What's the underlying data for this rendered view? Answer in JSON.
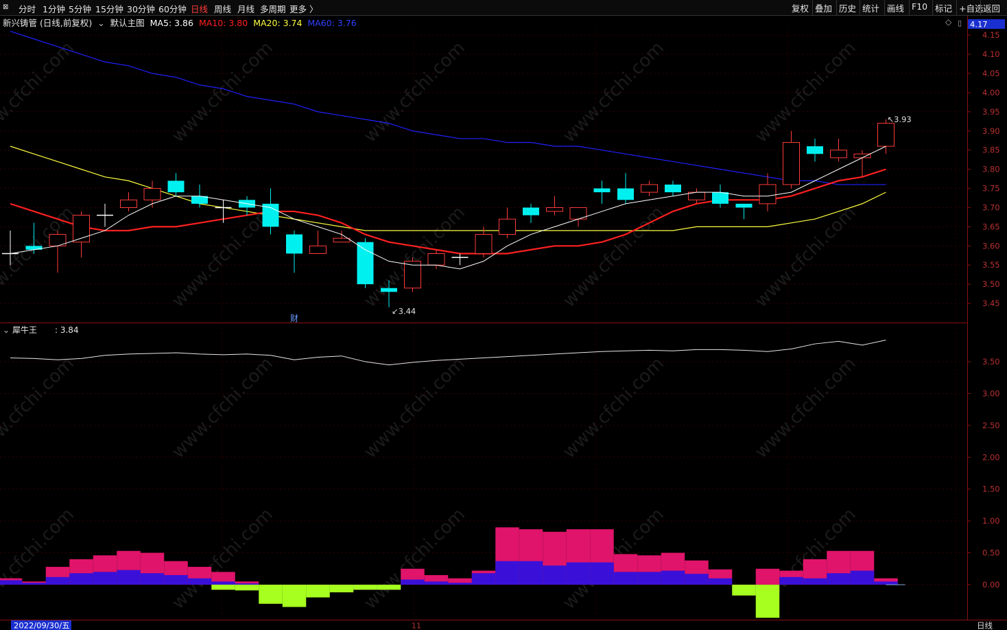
{
  "toolbar": {
    "periods": [
      {
        "label": "分时"
      },
      {
        "label": "1分钟"
      },
      {
        "label": "5分钟"
      },
      {
        "label": "15分钟"
      },
      {
        "label": "30分钟"
      },
      {
        "label": "60分钟"
      },
      {
        "label": "日线",
        "active": true
      },
      {
        "label": "周线"
      },
      {
        "label": "月线"
      },
      {
        "label": "多周期"
      },
      {
        "label": "更多 〉"
      }
    ],
    "right_tools": [
      {
        "label": "复权"
      },
      {
        "label": "叠加"
      },
      {
        "label": "历史"
      },
      {
        "label": "统计"
      },
      {
        "label": "画线"
      },
      {
        "label": "F10"
      },
      {
        "label": "标记"
      },
      {
        "label": "+自选"
      },
      {
        "label": "返回"
      }
    ]
  },
  "header": {
    "stock": "新兴铸管 (日线,前复权)",
    "template": "默认主图",
    "ma5": "MA5: 3.86",
    "ma10": "MA10: 3.80",
    "ma20": "MA20: 3.74",
    "ma60": "MA60: 3.76",
    "price_box": "4.17"
  },
  "indicator": {
    "name": "犀牛王",
    "value": ": 3.84"
  },
  "footer": {
    "date": "2022/09/30/五",
    "month_mark": "11",
    "period": "日线"
  },
  "markers": {
    "low": "3.44",
    "high": "3.93",
    "cai": "财"
  },
  "watermark": "www.cfchi.com",
  "colors": {
    "up": "#ff3b3b",
    "down": "#00f0f0",
    "ma5": "#ffffff",
    "ma10": "#ff2020",
    "ma20": "#ffff40",
    "ma60": "#2020ff",
    "hist_pink": "#e0146a",
    "hist_blue": "#3a10d8",
    "hist_green": "#a6ff1e"
  },
  "chart_data": [
    {
      "type": "candlestick",
      "title": "新兴铸管 (日线,前复权)",
      "ylim": [
        3.4,
        4.17
      ],
      "yticks": [
        3.45,
        3.5,
        3.55,
        3.6,
        3.65,
        3.7,
        3.75,
        3.8,
        3.85,
        3.9,
        3.95,
        4.0,
        4.05,
        4.1,
        4.15
      ],
      "candles": [
        {
          "o": 3.58,
          "c": 3.58,
          "h": 3.64,
          "l": 3.55
        },
        {
          "o": 3.6,
          "c": 3.59,
          "h": 3.66,
          "l": 3.58
        },
        {
          "o": 3.6,
          "c": 3.63,
          "h": 3.64,
          "l": 3.53
        },
        {
          "o": 3.61,
          "c": 3.68,
          "h": 3.69,
          "l": 3.57
        },
        {
          "o": 3.68,
          "c": 3.68,
          "h": 3.71,
          "l": 3.65
        },
        {
          "o": 3.7,
          "c": 3.72,
          "h": 3.74,
          "l": 3.69
        },
        {
          "o": 3.72,
          "c": 3.75,
          "h": 3.77,
          "l": 3.7
        },
        {
          "o": 3.77,
          "c": 3.74,
          "h": 3.79,
          "l": 3.73
        },
        {
          "o": 3.73,
          "c": 3.71,
          "h": 3.76,
          "l": 3.7
        },
        {
          "o": 3.7,
          "c": 3.7,
          "h": 3.72,
          "l": 3.66
        },
        {
          "o": 3.72,
          "c": 3.7,
          "h": 3.73,
          "l": 3.68
        },
        {
          "o": 3.71,
          "c": 3.65,
          "h": 3.75,
          "l": 3.63
        },
        {
          "o": 3.63,
          "c": 3.58,
          "h": 3.64,
          "l": 3.53
        },
        {
          "o": 3.58,
          "c": 3.6,
          "h": 3.64,
          "l": 3.58
        },
        {
          "o": 3.61,
          "c": 3.62,
          "h": 3.64,
          "l": 3.61
        },
        {
          "o": 3.61,
          "c": 3.5,
          "h": 3.62,
          "l": 3.49
        },
        {
          "o": 3.49,
          "c": 3.48,
          "h": 3.51,
          "l": 3.44
        },
        {
          "o": 3.49,
          "c": 3.56,
          "h": 3.57,
          "l": 3.48
        },
        {
          "o": 3.55,
          "c": 3.58,
          "h": 3.59,
          "l": 3.54
        },
        {
          "o": 3.57,
          "c": 3.57,
          "h": 3.58,
          "l": 3.55
        },
        {
          "o": 3.58,
          "c": 3.63,
          "h": 3.65,
          "l": 3.57
        },
        {
          "o": 3.63,
          "c": 3.67,
          "h": 3.7,
          "l": 3.62
        },
        {
          "o": 3.7,
          "c": 3.68,
          "h": 3.71,
          "l": 3.66
        },
        {
          "o": 3.69,
          "c": 3.7,
          "h": 3.73,
          "l": 3.68
        },
        {
          "o": 3.67,
          "c": 3.7,
          "h": 3.7,
          "l": 3.65
        },
        {
          "o": 3.75,
          "c": 3.74,
          "h": 3.77,
          "l": 3.71
        },
        {
          "o": 3.75,
          "c": 3.72,
          "h": 3.79,
          "l": 3.71
        },
        {
          "o": 3.74,
          "c": 3.76,
          "h": 3.77,
          "l": 3.73
        },
        {
          "o": 3.76,
          "c": 3.74,
          "h": 3.77,
          "l": 3.73
        },
        {
          "o": 3.72,
          "c": 3.74,
          "h": 3.75,
          "l": 3.71
        },
        {
          "o": 3.74,
          "c": 3.71,
          "h": 3.76,
          "l": 3.7
        },
        {
          "o": 3.71,
          "c": 3.7,
          "h": 3.71,
          "l": 3.67
        },
        {
          "o": 3.71,
          "c": 3.76,
          "h": 3.79,
          "l": 3.69
        },
        {
          "o": 3.76,
          "c": 3.87,
          "h": 3.9,
          "l": 3.75
        },
        {
          "o": 3.86,
          "c": 3.84,
          "h": 3.88,
          "l": 3.82
        },
        {
          "o": 3.83,
          "c": 3.85,
          "h": 3.88,
          "l": 3.82
        },
        {
          "o": 3.83,
          "c": 3.84,
          "h": 3.85,
          "l": 3.78
        },
        {
          "o": 3.86,
          "c": 3.92,
          "h": 3.93,
          "l": 3.84
        }
      ],
      "ma5": [
        3.58,
        3.59,
        3.6,
        3.62,
        3.64,
        3.68,
        3.71,
        3.73,
        3.73,
        3.72,
        3.71,
        3.7,
        3.67,
        3.65,
        3.63,
        3.59,
        3.56,
        3.55,
        3.55,
        3.54,
        3.56,
        3.6,
        3.63,
        3.65,
        3.67,
        3.69,
        3.71,
        3.72,
        3.73,
        3.74,
        3.74,
        3.73,
        3.73,
        3.74,
        3.77,
        3.8,
        3.83,
        3.86
      ],
      "ma10": [
        3.71,
        3.69,
        3.67,
        3.65,
        3.64,
        3.64,
        3.65,
        3.65,
        3.66,
        3.67,
        3.68,
        3.69,
        3.69,
        3.68,
        3.66,
        3.63,
        3.61,
        3.6,
        3.59,
        3.58,
        3.58,
        3.58,
        3.59,
        3.6,
        3.6,
        3.61,
        3.63,
        3.66,
        3.69,
        3.71,
        3.72,
        3.72,
        3.72,
        3.73,
        3.75,
        3.77,
        3.78,
        3.8
      ],
      "ma20": [
        3.86,
        3.84,
        3.82,
        3.8,
        3.78,
        3.77,
        3.75,
        3.73,
        3.71,
        3.7,
        3.69,
        3.68,
        3.67,
        3.66,
        3.65,
        3.64,
        3.64,
        3.64,
        3.64,
        3.64,
        3.64,
        3.64,
        3.64,
        3.64,
        3.64,
        3.64,
        3.64,
        3.64,
        3.64,
        3.65,
        3.65,
        3.65,
        3.65,
        3.66,
        3.67,
        3.69,
        3.71,
        3.74
      ],
      "ma60": [
        4.16,
        4.14,
        4.12,
        4.1,
        4.08,
        4.07,
        4.05,
        4.04,
        4.02,
        4.01,
        3.99,
        3.98,
        3.97,
        3.95,
        3.94,
        3.93,
        3.92,
        3.9,
        3.89,
        3.88,
        3.88,
        3.87,
        3.87,
        3.86,
        3.86,
        3.85,
        3.84,
        3.83,
        3.82,
        3.81,
        3.8,
        3.79,
        3.78,
        3.77,
        3.77,
        3.76,
        3.76,
        3.76
      ],
      "annotations": [
        {
          "label": "3.44",
          "candle": 16
        },
        {
          "label": "3.93",
          "candle": 37
        },
        {
          "label": "财",
          "candle": 12
        }
      ]
    },
    {
      "type": "line",
      "title": "犀牛王",
      "ylim": [
        -0.55,
        4.05
      ],
      "yticks": [
        0.0,
        0.5,
        1.0,
        1.5,
        2.0,
        2.5,
        3.0,
        3.5
      ],
      "line": [
        3.56,
        3.55,
        3.53,
        3.55,
        3.6,
        3.62,
        3.63,
        3.64,
        3.62,
        3.61,
        3.62,
        3.6,
        3.53,
        3.57,
        3.59,
        3.5,
        3.45,
        3.49,
        3.52,
        3.54,
        3.56,
        3.58,
        3.6,
        3.62,
        3.64,
        3.66,
        3.67,
        3.68,
        3.67,
        3.69,
        3.69,
        3.68,
        3.66,
        3.7,
        3.78,
        3.82,
        3.76,
        3.84
      ],
      "bars_pink": [
        0.1,
        0.05,
        0.28,
        0.4,
        0.46,
        0.53,
        0.5,
        0.37,
        0.28,
        0.2,
        0.05,
        0.0,
        0.0,
        0.0,
        0.0,
        0.0,
        0.0,
        0.25,
        0.15,
        0.1,
        0.22,
        0.9,
        0.87,
        0.83,
        0.87,
        0.87,
        0.48,
        0.46,
        0.5,
        0.38,
        0.24,
        0.0,
        0.25,
        0.22,
        0.4,
        0.53,
        0.53,
        0.1
      ],
      "bars_blue": [
        0.07,
        0.03,
        0.12,
        0.18,
        0.2,
        0.23,
        0.18,
        0.15,
        0.1,
        0.05,
        0.02,
        -0.1,
        -0.13,
        -0.13,
        -0.1,
        -0.08,
        -0.08,
        0.08,
        0.05,
        0.03,
        0.18,
        0.37,
        0.37,
        0.3,
        0.35,
        0.35,
        0.2,
        0.2,
        0.22,
        0.17,
        0.1,
        -0.08,
        -0.18,
        0.12,
        0.1,
        0.18,
        0.22,
        0.05
      ],
      "bars_green": [
        0,
        0,
        0,
        0,
        0,
        0,
        0,
        0,
        0,
        -0.08,
        -0.09,
        -0.3,
        -0.35,
        -0.2,
        -0.12,
        -0.08,
        -0.08,
        0,
        0,
        0,
        0,
        0,
        0,
        0,
        0,
        0,
        0,
        0,
        0,
        0,
        0,
        -0.17,
        -0.52,
        0,
        0,
        0,
        0,
        0
      ]
    }
  ]
}
